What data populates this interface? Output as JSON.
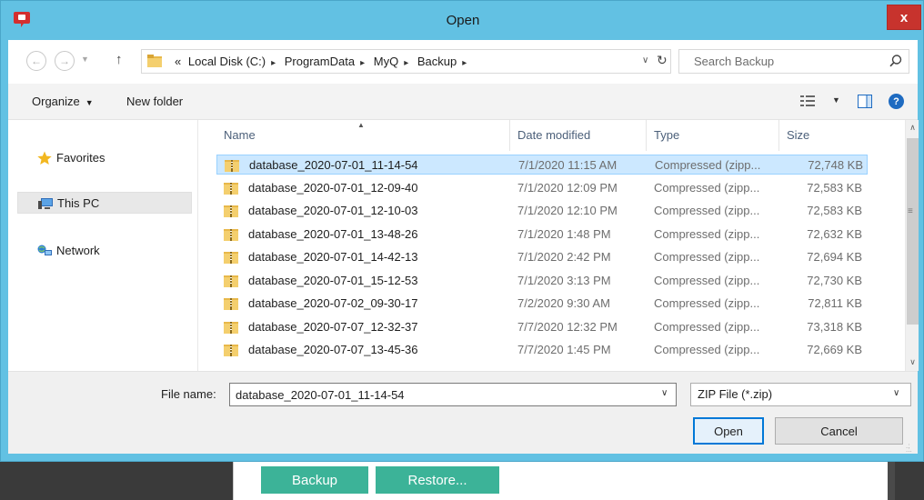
{
  "window": {
    "title": "Open",
    "close_label": "x"
  },
  "address": {
    "crumb_overflow": "«",
    "crumbs": [
      "Local Disk (C:)",
      "ProgramData",
      "MyQ",
      "Backup"
    ],
    "separator": "▸",
    "search_placeholder": "Search Backup"
  },
  "toolbar": {
    "organize_label": "Organize",
    "new_folder_label": "New folder"
  },
  "nav": {
    "items": [
      {
        "label": "Favorites",
        "icon": "star-icon",
        "selected": false
      },
      {
        "label": "This PC",
        "icon": "computer-icon",
        "selected": true
      },
      {
        "label": "Network",
        "icon": "network-icon",
        "selected": false
      }
    ]
  },
  "columns": {
    "name": "Name",
    "date": "Date modified",
    "type": "Type",
    "size": "Size"
  },
  "files": [
    {
      "name": "database_2020-07-01_11-14-54",
      "date": "7/1/2020 11:15 AM",
      "type": "Compressed (zipp...",
      "size": "72,748 KB",
      "selected": true
    },
    {
      "name": "database_2020-07-01_12-09-40",
      "date": "7/1/2020 12:09 PM",
      "type": "Compressed (zipp...",
      "size": "72,583 KB",
      "selected": false
    },
    {
      "name": "database_2020-07-01_12-10-03",
      "date": "7/1/2020 12:10 PM",
      "type": "Compressed (zipp...",
      "size": "72,583 KB",
      "selected": false
    },
    {
      "name": "database_2020-07-01_13-48-26",
      "date": "7/1/2020 1:48 PM",
      "type": "Compressed (zipp...",
      "size": "72,632 KB",
      "selected": false
    },
    {
      "name": "database_2020-07-01_14-42-13",
      "date": "7/1/2020 2:42 PM",
      "type": "Compressed (zipp...",
      "size": "72,694 KB",
      "selected": false
    },
    {
      "name": "database_2020-07-01_15-12-53",
      "date": "7/1/2020 3:13 PM",
      "type": "Compressed (zipp...",
      "size": "72,730 KB",
      "selected": false
    },
    {
      "name": "database_2020-07-02_09-30-17",
      "date": "7/2/2020 9:30 AM",
      "type": "Compressed (zipp...",
      "size": "72,811 KB",
      "selected": false
    },
    {
      "name": "database_2020-07-07_12-32-37",
      "date": "7/7/2020 12:32 PM",
      "type": "Compressed (zipp...",
      "size": "73,318 KB",
      "selected": false
    },
    {
      "name": "database_2020-07-07_13-45-36",
      "date": "7/7/2020 1:45 PM",
      "type": "Compressed (zipp...",
      "size": "72,669 KB",
      "selected": false
    }
  ],
  "bottom": {
    "file_name_label": "File name:",
    "file_name_value": "database_2020-07-01_11-14-54",
    "file_type_value": "ZIP File (*.zip)",
    "open_label": "Open",
    "cancel_label": "Cancel"
  },
  "app": {
    "backup_label": "Backup",
    "restore_label": "Restore..."
  },
  "colors": {
    "titlebar": "#62c1e3",
    "close": "#c7332d",
    "selection": "#cce8ff",
    "app_button": "#3cb398"
  }
}
